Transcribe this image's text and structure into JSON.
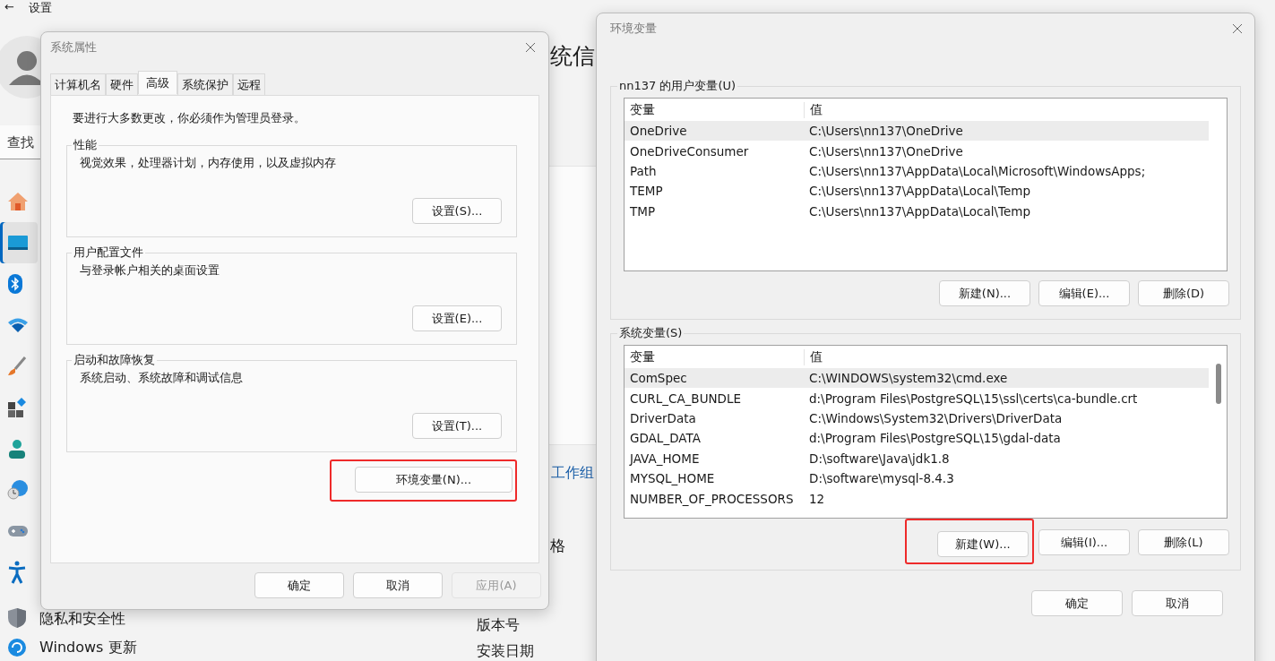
{
  "settings_app": {
    "back": "←",
    "title": "设置",
    "search": {
      "placeholder": "查找"
    },
    "sidebar": [
      {
        "kind": "home",
        "selected": false
      },
      {
        "kind": "monitor",
        "selected": true
      },
      {
        "kind": "bluetooth",
        "selected": false
      },
      {
        "kind": "wifi",
        "selected": false
      },
      {
        "kind": "brush",
        "selected": false
      },
      {
        "kind": "apps",
        "selected": false
      },
      {
        "kind": "person",
        "selected": false
      },
      {
        "kind": "globe",
        "selected": false
      },
      {
        "kind": "gamepad",
        "selected": false
      },
      {
        "kind": "accessibility",
        "selected": false
      },
      {
        "kind": "shield",
        "label": "隐私和安全性",
        "selected": false
      },
      {
        "kind": "refresh",
        "label": "Windows 更新",
        "selected": false
      }
    ],
    "page_title": "统信",
    "link": "工作组",
    "section": "格",
    "rows": [
      "版本号",
      "安装日期"
    ]
  },
  "system_properties": {
    "title": "系统属性",
    "tabs": [
      {
        "label": "计算机名",
        "selected": false
      },
      {
        "label": "硬件",
        "selected": false
      },
      {
        "label": "高级",
        "selected": true
      },
      {
        "label": "系统保护",
        "selected": false
      },
      {
        "label": "远程",
        "selected": false
      }
    ],
    "notice": "要进行大多数更改，你必须作为管理员登录。",
    "groups": [
      {
        "title": "性能",
        "description": "视觉效果，处理器计划，内存使用，以及虚拟内存",
        "button": "设置(S)..."
      },
      {
        "title": "用户配置文件",
        "description": "与登录帐户相关的桌面设置",
        "button": "设置(E)..."
      },
      {
        "title": "启动和故障恢复",
        "description": "系统启动、系统故障和调试信息",
        "button": "设置(T)..."
      }
    ],
    "env_button": {
      "label": "环境变量(N)...",
      "highlighted": true
    },
    "buttons": [
      {
        "label": "确定",
        "disabled": false
      },
      {
        "label": "取消",
        "disabled": false
      },
      {
        "label": "应用(A)",
        "disabled": true
      }
    ]
  },
  "environment_variables": {
    "title": "环境变量",
    "sections": [
      {
        "title": "nn137 的用户变量(U)",
        "columns": [
          "变量",
          "值"
        ],
        "scrollbar": false,
        "rows": [
          {
            "name": "OneDrive",
            "value": "C:\\Users\\nn137\\OneDrive",
            "selected": true
          },
          {
            "name": "OneDriveConsumer",
            "value": "C:\\Users\\nn137\\OneDrive",
            "selected": false
          },
          {
            "name": "Path",
            "value": "C:\\Users\\nn137\\AppData\\Local\\Microsoft\\WindowsApps;",
            "selected": false
          },
          {
            "name": "TEMP",
            "value": "C:\\Users\\nn137\\AppData\\Local\\Temp",
            "selected": false
          },
          {
            "name": "TMP",
            "value": "C:\\Users\\nn137\\AppData\\Local\\Temp",
            "selected": false
          }
        ],
        "buttons": [
          {
            "label": "新建(N)...",
            "highlighted": false
          },
          {
            "label": "编辑(E)...",
            "highlighted": false
          },
          {
            "label": "删除(D)",
            "highlighted": false
          }
        ]
      },
      {
        "title": "系统变量(S)",
        "columns": [
          "变量",
          "值"
        ],
        "scrollbar": true,
        "rows": [
          {
            "name": "ComSpec",
            "value": "C:\\WINDOWS\\system32\\cmd.exe",
            "selected": true
          },
          {
            "name": "CURL_CA_BUNDLE",
            "value": "d:\\Program Files\\PostgreSQL\\15\\ssl\\certs\\ca-bundle.crt",
            "selected": false
          },
          {
            "name": "DriverData",
            "value": "C:\\Windows\\System32\\Drivers\\DriverData",
            "selected": false
          },
          {
            "name": "GDAL_DATA",
            "value": "d:\\Program Files\\PostgreSQL\\15\\gdal-data",
            "selected": false
          },
          {
            "name": "JAVA_HOME",
            "value": "D:\\software\\Java\\jdk1.8",
            "selected": false
          },
          {
            "name": "MYSQL_HOME",
            "value": "D:\\software\\mysql-8.4.3",
            "selected": false
          },
          {
            "name": "NUMBER_OF_PROCESSORS",
            "value": "12",
            "selected": false
          }
        ],
        "buttons": [
          {
            "label": "新建(W)...",
            "highlighted": true
          },
          {
            "label": "编辑(I)...",
            "highlighted": false
          },
          {
            "label": "删除(L)",
            "highlighted": false
          }
        ]
      }
    ],
    "buttons": [
      {
        "label": "确定"
      },
      {
        "label": "取消"
      }
    ]
  }
}
